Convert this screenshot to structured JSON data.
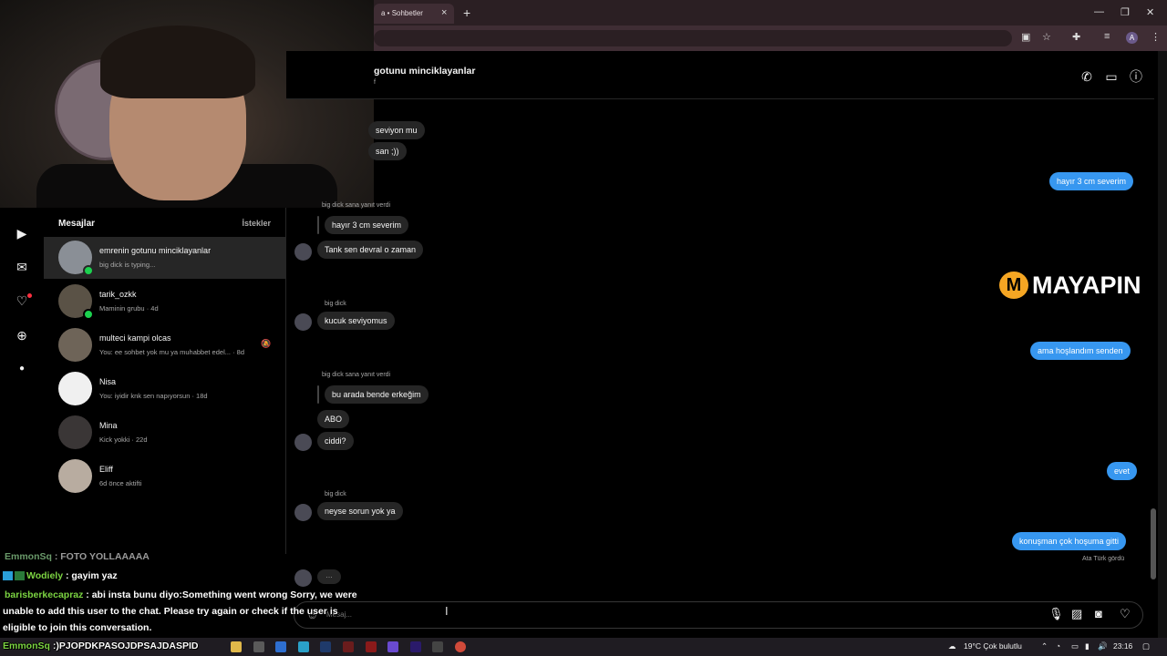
{
  "browser": {
    "tab_title": "a • Sohbetler",
    "tab_close": "×",
    "new_tab": "+",
    "profile_initial": "A"
  },
  "rail": {
    "icons": [
      "reels-icon",
      "messenger-icon",
      "heart-icon",
      "create-icon",
      "profile-icon"
    ]
  },
  "inbox": {
    "title": "Mesajlar",
    "requests_label": "İstekler",
    "conversations": [
      {
        "name": "emrenin gotunu minciklayanlar",
        "preview": "big dick is typing...",
        "online": true,
        "active": true
      },
      {
        "name": "tarik_ozkk",
        "preview": "Maminin grubu · 4d",
        "online": true,
        "active": false
      },
      {
        "name": "multeci kampi olcas",
        "preview": "You: ee sohbet yok mu ya muhabbet edel... · 8d",
        "muted": true
      },
      {
        "name": "Nisa",
        "preview": "You: iyidir knk sen napıyorsun · 18d"
      },
      {
        "name": "Mina",
        "preview": "Kick yokki · 22d"
      },
      {
        "name": "Eliff",
        "preview": "6d önce aktifti"
      }
    ]
  },
  "chat": {
    "header_name": "gotunu minciklayanlar",
    "header_sub": "f",
    "header_icons": [
      "phone-icon",
      "video-icon",
      "info-icon"
    ],
    "messages": {
      "m1": "seviyon mu",
      "m2": "san ;))",
      "m3": "hayır 3 cm severim",
      "m4_meta": "big dick sana yanıt verdi",
      "m4_quote": "hayır 3 cm severim",
      "m5": "Tank sen devral o zaman",
      "m6_sender": "big dick",
      "m6": "kucuk seviyomus",
      "m7": "ama hoşlandım senden",
      "m8_meta": "big dick sana yanıt verdi",
      "m8_quote": "bu arada bende erkeğim",
      "m9": "ABO",
      "m10": "ciddi?",
      "m11": "evet",
      "m12_sender": "big dick",
      "m12": "neyse sorun yok ya",
      "m13": "konuşman çok hoşuma gitti",
      "seen": "Ata Türk gördü",
      "typing": "..."
    },
    "composer_placeholder": "Mesaj...",
    "composer_icons": [
      "microphone-icon",
      "image-icon",
      "sticker-icon",
      "heart-icon"
    ]
  },
  "watermark": {
    "logo_letter": "M",
    "text": "MAYAPIN"
  },
  "stream_chat": [
    {
      "user": "EmmonSq",
      "text": " : FOTO YOLLAAAAA"
    },
    {
      "user": "Wodiely",
      "text": " : gayim yaz"
    },
    {
      "user": "barisberkecapraz",
      "text": " : abi insta bunu diyo:Something went wrong Sorry, we were"
    },
    {
      "text": "unable to add this user to the chat. Please try again or check if the user is"
    },
    {
      "text": "eligible to join this conversation."
    },
    {
      "user": "EmmonSq",
      "text": " :)PJOPDKPASOJDPSAJDASPID"
    }
  ],
  "taskbar": {
    "weather": "19°C  Çok bulutlu",
    "time": "23:16"
  }
}
